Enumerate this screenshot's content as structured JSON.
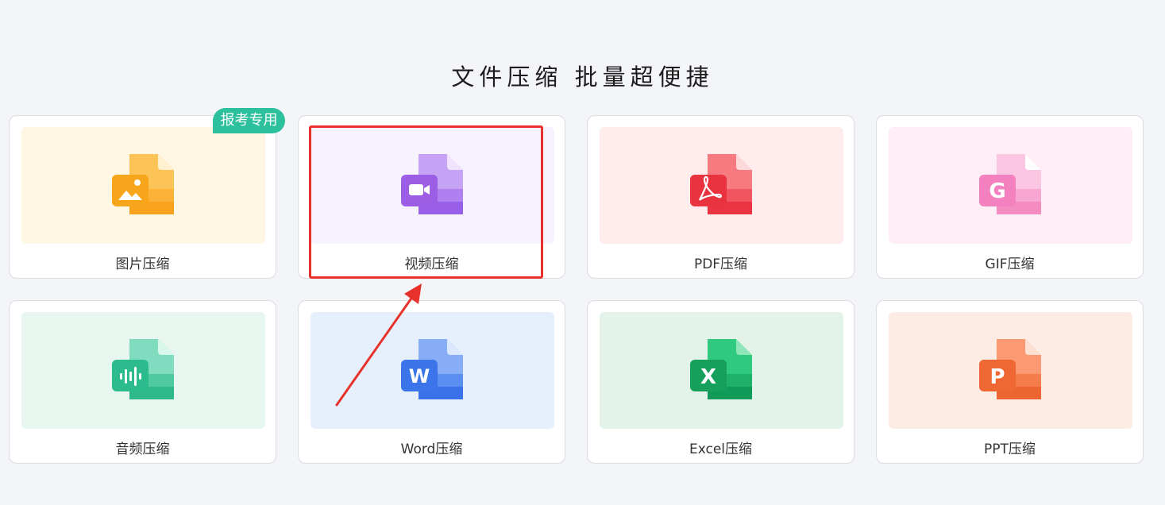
{
  "headline": "文件压缩  批量超便捷",
  "badge": "报考专用",
  "cards": [
    {
      "label": "图片压缩",
      "icon": "image-file-icon",
      "thumb_bg": "#fff6e3",
      "color": "#f9a21e"
    },
    {
      "label": "视频压缩",
      "icon": "video-file-icon",
      "thumb_bg": "#f6f2fe",
      "color": "#9a5fe8"
    },
    {
      "label": "PDF压缩",
      "icon": "pdf-file-icon",
      "thumb_bg": "#ffeced",
      "color": "#ec3845"
    },
    {
      "label": "GIF压缩",
      "icon": "gif-file-icon",
      "thumb_bg": "#ffeef6",
      "color": "#f47bbd"
    },
    {
      "label": "音频压缩",
      "icon": "audio-file-icon",
      "thumb_bg": "#e7f6ef",
      "color": "#2fbe8f"
    },
    {
      "label": "Word压缩",
      "icon": "word-file-icon",
      "thumb_bg": "#e6f0fd",
      "color": "#3a72ec"
    },
    {
      "label": "Excel压缩",
      "icon": "excel-file-icon",
      "thumb_bg": "#e3f3ea",
      "color": "#1ea160"
    },
    {
      "label": "PPT压缩",
      "icon": "ppt-file-icon",
      "thumb_bg": "#fdece3",
      "color": "#f06a35"
    }
  ],
  "annotation_color": "#e8312b"
}
